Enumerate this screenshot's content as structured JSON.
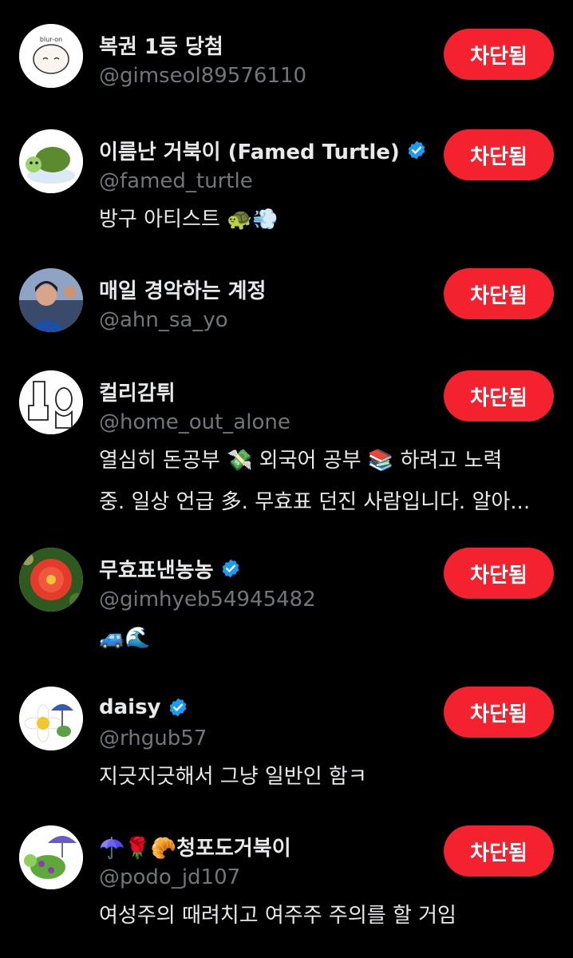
{
  "block_label": "차단됨",
  "accounts": [
    {
      "name": "복권 1등 당첨",
      "handle": "@gimseol89576110",
      "verified": false,
      "bio": ""
    },
    {
      "name": "이름난 거북이 (Famed Turtle)",
      "handle": "@famed_turtle",
      "verified": true,
      "bio": "방구 아티스트 🐢💨"
    },
    {
      "name": "매일 경악하는 계정",
      "handle": "@ahn_sa_yo",
      "verified": false,
      "bio": ""
    },
    {
      "name": "컬리감튀",
      "handle": "@home_out_alone",
      "verified": false,
      "bio": "열심히 돈공부 💸 외국어 공부 📚 하려고 노력",
      "bio2": "중. 일상 언급 多. 무효표 던진 사람입니다. 알아..."
    },
    {
      "name": "무효표낸농농",
      "handle": "@gimhyeb54945482",
      "verified": true,
      "bio": "🚙🌊"
    },
    {
      "name": "daisy",
      "handle": "@rhgub57",
      "verified": true,
      "bio": "지긋지긋해서 그냥 일반인 함ㅋ"
    },
    {
      "name": "☂️🌹🥐청포도거북이",
      "handle": "@podo_jd107",
      "verified": false,
      "bio": "여성주의 때려치고 여주주 주의를 할 거임"
    }
  ],
  "colors": {
    "background": "#000000",
    "block_button": "#f4212e",
    "verified": "#1d9bf0",
    "secondary_text": "#71767b"
  },
  "icons": {
    "verified": "verified-badge-icon"
  }
}
